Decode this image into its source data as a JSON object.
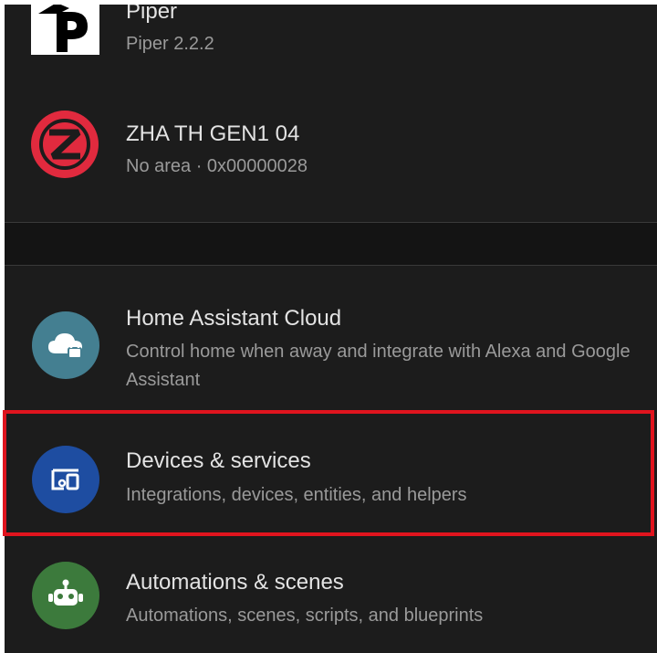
{
  "integrations": [
    {
      "title": "Piper",
      "subtitle": "Piper 2.2.2",
      "icon": "piper-logo-icon"
    },
    {
      "title": "ZHA TH GEN1 04",
      "subtitle": "No area · 0x00000028",
      "icon": "zigbee-logo-icon"
    }
  ],
  "settings": [
    {
      "title": "Home Assistant Cloud",
      "subtitle": "Control home when away and integrate with Alexa and Google Assistant",
      "icon": "cloud-lock-icon",
      "icon_color": "#447f91"
    },
    {
      "title": "Devices & services",
      "subtitle": "Integrations, devices, entities, and helpers",
      "icon": "devices-icon",
      "icon_color": "#1e4da1"
    },
    {
      "title": "Automations & scenes",
      "subtitle": "Automations, scenes, scripts, and blueprints",
      "icon": "robot-icon",
      "icon_color": "#3c7a3c"
    }
  ],
  "colors": {
    "background": "#1c1c1c",
    "highlight": "#e0141e",
    "zigbee": "#e12a3e"
  }
}
